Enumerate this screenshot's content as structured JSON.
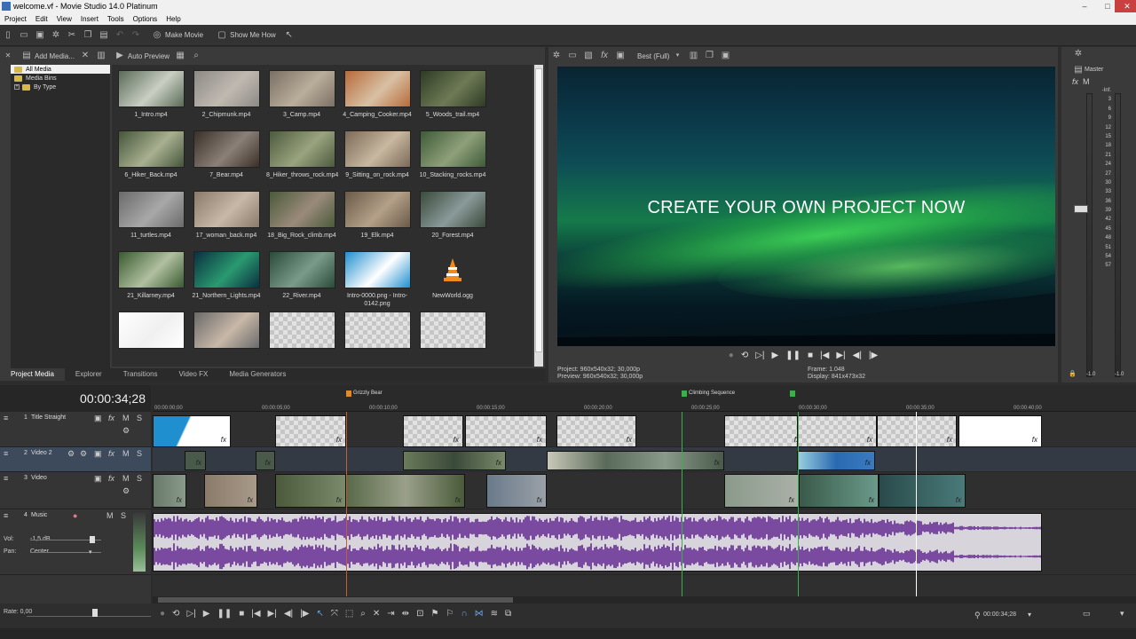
{
  "window": {
    "title": "welcome.vf - Movie Studio 14.0 Platinum",
    "minimize": "–",
    "maximize": "□",
    "close": "✕"
  },
  "menu": [
    "Project",
    "Edit",
    "View",
    "Insert",
    "Tools",
    "Options",
    "Help"
  ],
  "toolbar": {
    "make_movie": "Make Movie",
    "show_me_how": "Show Me How"
  },
  "media": {
    "add_media": "Add Media...",
    "auto_preview": "Auto Preview",
    "tree": [
      "All Media",
      "Media Bins",
      "By Type"
    ],
    "items": [
      {
        "label": "1_Intro.mp4",
        "c1": "#5b6a58",
        "c2": "#c9cfc3"
      },
      {
        "label": "2_Chipmunk.mp4",
        "c1": "#8c8a86",
        "c2": "#c0b9b0"
      },
      {
        "label": "3_Camp.mp4",
        "c1": "#7a7064",
        "c2": "#b9ad9b"
      },
      {
        "label": "4_Camping_Cooker.mp4",
        "c1": "#b86b3a",
        "c2": "#d8c0a4"
      },
      {
        "label": "5_Woods_trail.mp4",
        "c1": "#2e3b25",
        "c2": "#6e7a55"
      },
      {
        "label": "6_Hiker_Back.mp4",
        "c1": "#45553a",
        "c2": "#a8b090"
      },
      {
        "label": "7_Bear.mp4",
        "c1": "#3a3028",
        "c2": "#8a8078"
      },
      {
        "label": "8_Hiker_throws_rock.mp4",
        "c1": "#4c5a3e",
        "c2": "#9aa37e"
      },
      {
        "label": "9_Sitting_on_rock.mp4",
        "c1": "#7a6a58",
        "c2": "#c8b8a0"
      },
      {
        "label": "10_Stacking_rocks.mp4",
        "c1": "#3f5a38",
        "c2": "#8ea07a"
      },
      {
        "label": "11_turtles.mp4",
        "c1": "#6a6a6a",
        "c2": "#a8a8a8"
      },
      {
        "label": "17_woman_back.mp4",
        "c1": "#8a7a6a",
        "c2": "#c8b8a8"
      },
      {
        "label": "18_Big_Rock_climb.mp4",
        "c1": "#4a5a3a",
        "c2": "#9a8a7a"
      },
      {
        "label": "19_Elk.mp4",
        "c1": "#6a5a48",
        "c2": "#b4a088"
      },
      {
        "label": "20_Forest.mp4",
        "c1": "#3a4a3a",
        "c2": "#8a9a9a"
      },
      {
        "label": "21_Killarney.mp4",
        "c1": "#3a5a30",
        "c2": "#b0c0a0"
      },
      {
        "label": "21_Northern_Lights.mp4",
        "c1": "#0a3040",
        "c2": "#2a9a70"
      },
      {
        "label": "22_River.mp4",
        "c1": "#2a4a3a",
        "c2": "#7a9a8a"
      },
      {
        "label": "Intro-0000.png - Intro-0142.png",
        "c1": "#1f8fcf",
        "c2": "#ffffff"
      },
      {
        "label": "NewWorld.ogg",
        "c1": "#2e2e2e",
        "c2": "#2e2e2e"
      },
      {
        "label": "",
        "c1": "#ffffff",
        "c2": "#f0f0f0"
      },
      {
        "label": "",
        "c1": "#6a6a6a",
        "c2": "#c8b8a8"
      },
      {
        "label": "",
        "c1": "#c6c6c6",
        "c2": "#e2e2e2"
      },
      {
        "label": "",
        "c1": "#c6c6c6",
        "c2": "#e2e2e2"
      },
      {
        "label": "",
        "c1": "#c6c6c6",
        "c2": "#e2e2e2"
      }
    ]
  },
  "panel_tabs": [
    "Project Media",
    "Explorer",
    "Transitions",
    "Video FX",
    "Media Generators"
  ],
  "preview": {
    "quality": "Best (Full)",
    "caption": "CREATE YOUR OWN PROJECT NOW",
    "project": "Project:   960x540x32; 30,000p",
    "preview_info": "Preview:  960x540x32; 30,000p",
    "frame": "Frame:      1.048",
    "display": "Display:    841x473x32"
  },
  "master": {
    "label": "Master",
    "scale": [
      "-Inf.",
      "3",
      "6",
      "9",
      "12",
      "15",
      "18",
      "21",
      "24",
      "27",
      "30",
      "33",
      "36",
      "39",
      "42",
      "45",
      "48",
      "51",
      "54",
      "57"
    ],
    "bottom_left": "-1.0",
    "bottom_right": "-1.0"
  },
  "timeline": {
    "timecode": "00:00:34;28",
    "ruler": [
      "00:00:00;00",
      "00:00:05;00",
      "00:00:10;00",
      "00:00:15;00",
      "00:00:20;00",
      "00:00:25;00",
      "00:00:30;00",
      "00:00:35;00",
      "00:00:40;00"
    ],
    "markers": [
      "Grizzly Bear",
      "Climbing Sequence"
    ],
    "tracks": [
      {
        "num": "1",
        "name": "Title Straight"
      },
      {
        "num": "2",
        "name": "Video 2"
      },
      {
        "num": "3",
        "name": "Video"
      },
      {
        "num": "4",
        "name": "Music"
      }
    ],
    "vol_label": "Vol:",
    "vol_value": "-1,5 dB",
    "pan_label": "Pan:",
    "pan_value": "Center",
    "rate_label": "Rate: 0,00",
    "end_time": "00:00:34;28"
  },
  "colors": {
    "accent": "#3a78c8",
    "audio_wave": "#7a4aa0",
    "marker": "#e08a2a",
    "marker_green": "#3ab04a"
  }
}
